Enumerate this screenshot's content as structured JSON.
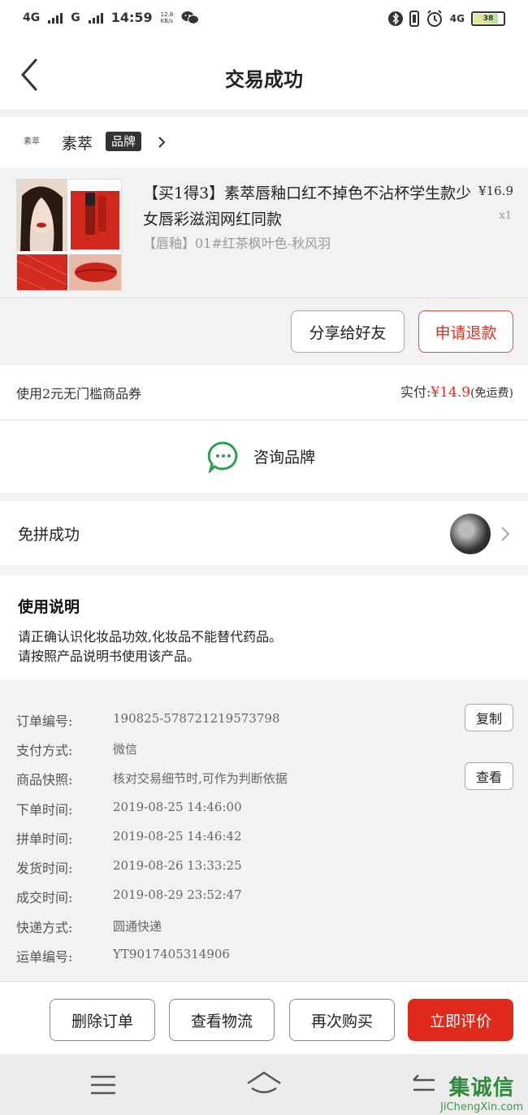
{
  "status_bar": {
    "network1": "4G",
    "network2": "G",
    "time": "14:59",
    "speed": "12.8",
    "speed_unit": "KB/s",
    "network3": "4G",
    "battery_text": "38",
    "icons": [
      "signal-icon",
      "wechat-icon",
      "bluetooth-icon",
      "vibrate-icon",
      "alarm-icon",
      "battery-icon"
    ]
  },
  "header": {
    "title": "交易成功",
    "back_icon": "chevron-left-icon"
  },
  "brand": {
    "logo_text": "素萃",
    "name": "素萃",
    "badge": "品牌"
  },
  "product": {
    "title": "【买1得3】素萃唇釉口红不掉色不沾杯学生款少女唇彩滋润网红同款",
    "spec": "【唇釉】01#红茶枫叶色-秋风羽",
    "price": "¥16.9",
    "quantity": "x1"
  },
  "actions": {
    "share_label": "分享给好友",
    "refund_label": "申请退款"
  },
  "payment": {
    "coupon": "使用2元无门槛商品券",
    "paid_label": "实付:",
    "paid_amount": "¥14.9",
    "shipping_note": "(免运费)"
  },
  "consult": {
    "label": "咨询品牌"
  },
  "group": {
    "label": "免拼成功"
  },
  "usage": {
    "title": "使用说明",
    "line1": "请正确认识化妆品功效,化妆品不能替代药品。",
    "line2": "请按照产品说明书使用该产品。"
  },
  "order_info": {
    "rows": [
      {
        "label": "订单编号:",
        "value": "190825-578721219573798"
      },
      {
        "label": "支付方式:",
        "value": "微信"
      },
      {
        "label": "商品快照:",
        "value": "核对交易细节时,可作为判断依据"
      },
      {
        "label": "下单时间:",
        "value": "2019-08-25 14:46:00"
      },
      {
        "label": "拼单时间:",
        "value": "2019-08-25 14:46:42"
      },
      {
        "label": "发货时间:",
        "value": "2019-08-26 13:33:25"
      },
      {
        "label": "成交时间:",
        "value": "2019-08-29 23:52:47"
      },
      {
        "label": "快递方式:",
        "value": "圆通快递"
      },
      {
        "label": "运单编号:",
        "value": "YT9017405314906"
      }
    ],
    "copy_label": "复制",
    "view_label": "查看"
  },
  "bottom_actions": {
    "delete": "删除订单",
    "logistics": "查看物流",
    "rebuy": "再次购买",
    "review": "立即评价"
  },
  "watermark": {
    "big": "集诚信",
    "small": "JiChengXin.com"
  },
  "colors": {
    "accent_red": "#e02a1c",
    "consult_green": "#2aa050"
  }
}
